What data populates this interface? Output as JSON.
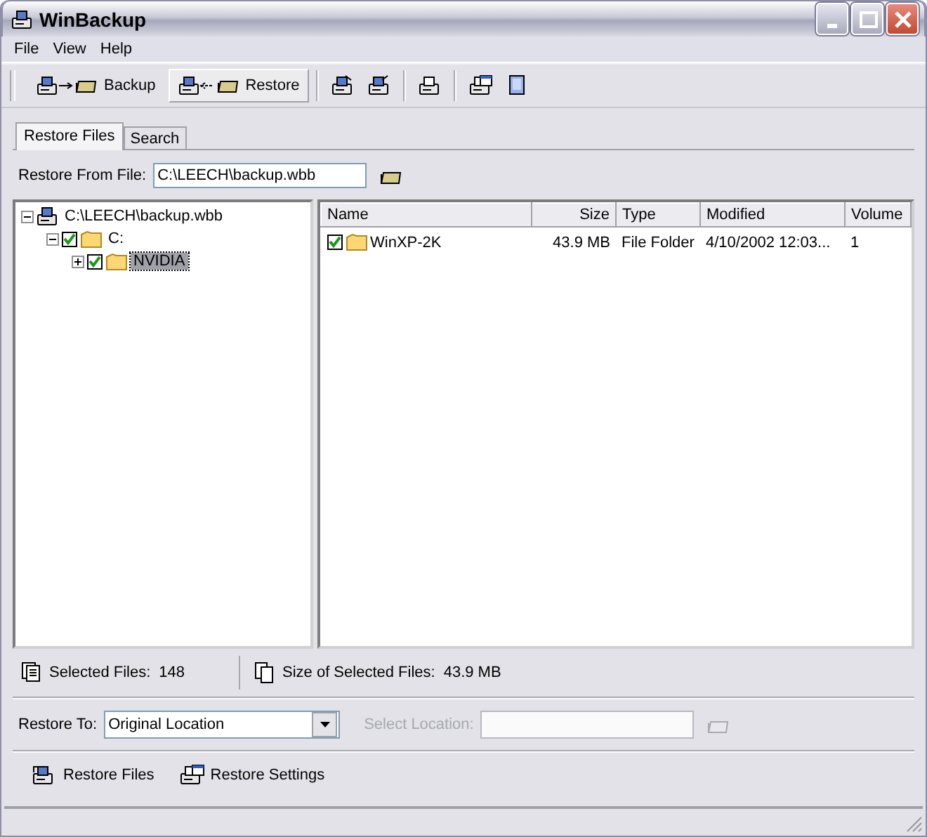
{
  "window": {
    "title": "WinBackup"
  },
  "menu": [
    "File",
    "View",
    "Help"
  ],
  "toolbar": [
    {
      "kind": "backup",
      "label": "Backup",
      "selected": false
    },
    {
      "kind": "restore",
      "label": "Restore",
      "selected": true
    }
  ],
  "tabs": [
    {
      "label": "Restore Files",
      "selected": true
    },
    {
      "label": "Search",
      "selected": false
    }
  ],
  "restore_from": {
    "label": "Restore From File:",
    "value": "C:\\LEECH\\backup.wbb"
  },
  "tree": [
    {
      "kind": "archive",
      "label": "C:\\LEECH\\backup.wbb",
      "expanded": true,
      "selected": false,
      "children": [
        {
          "kind": "folder",
          "label": "C:",
          "checked": true,
          "expanded": true,
          "selected": false,
          "children": [
            {
              "kind": "folder",
              "label": "NVIDIA",
              "checked": true,
              "expanded": false,
              "selected": true
            }
          ]
        }
      ]
    }
  ],
  "list": {
    "columns": [
      "Name",
      "Size",
      "Type",
      "Modified",
      "Volume"
    ],
    "rows": [
      {
        "checked": true,
        "cells": [
          "WinXP-2K",
          "43.9 MB",
          "File Folder",
          "4/10/2002 12:03...",
          "1"
        ]
      }
    ]
  },
  "summary": [
    {
      "label": "Selected Files:",
      "value": "148"
    },
    {
      "label": "Size of Selected Files:",
      "value": "43.9 MB"
    }
  ],
  "restore_to": {
    "label": "Restore To:",
    "value": "Original Location"
  },
  "select_location": {
    "label": "Select Location:",
    "disabled": true
  },
  "buttons": [
    "Restore Files",
    "Restore Settings"
  ]
}
